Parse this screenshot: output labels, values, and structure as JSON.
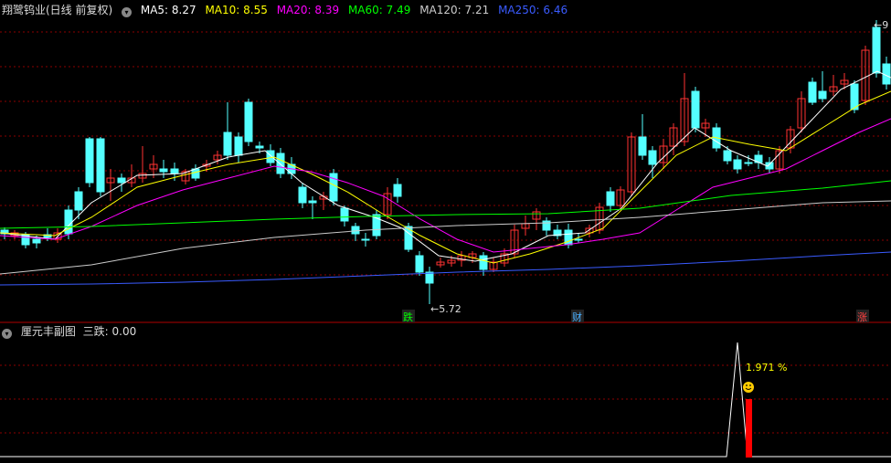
{
  "header": {
    "stock": "翔鹭钨业(日线 前复权)",
    "ma": [
      {
        "label": "MA5: 8.27",
        "color": "#ffffff"
      },
      {
        "label": "MA10: 8.55",
        "color": "#ffff00"
      },
      {
        "label": "MA20: 8.39",
        "color": "#ff00ff"
      },
      {
        "label": "MA60: 7.49",
        "color": "#00ff00"
      },
      {
        "label": "MA120: 7.21",
        "color": "#cccccc"
      },
      {
        "label": "MA250: 6.46",
        "color": "#3a5bff"
      }
    ]
  },
  "main": {
    "low_annotation": "←5.72",
    "high_annotation": "←9",
    "markers": [
      {
        "text": "跌",
        "color": "#00ff00"
      },
      {
        "text": "财",
        "color": "#4ab0ff"
      },
      {
        "text": "涨",
        "color": "#ff4040"
      }
    ]
  },
  "sub": {
    "title": "厘元丰副图",
    "indicator": "三跌: 0.00",
    "percent_label": "1.971 %"
  },
  "colors": {
    "up": "#ff3232",
    "down": "#54ffff",
    "background": "#000000",
    "grid": "#8b0000"
  }
}
